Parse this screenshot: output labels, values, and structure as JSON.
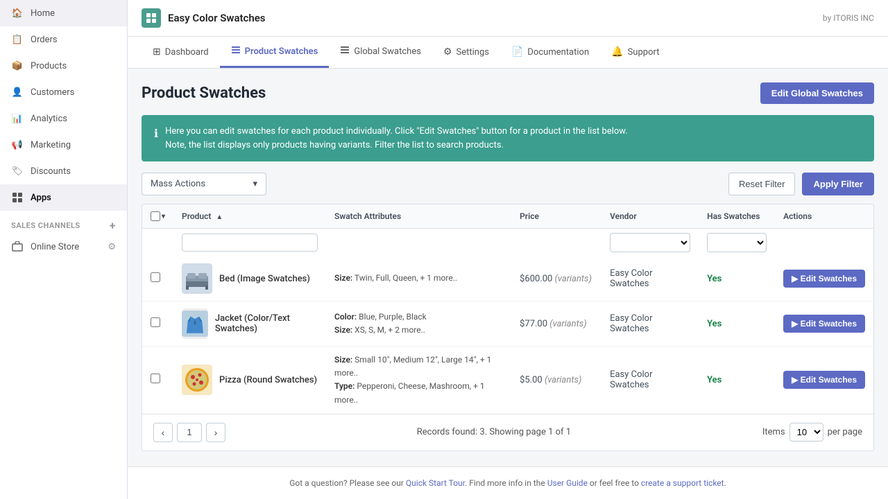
{
  "sidebar": {
    "items": [
      {
        "label": "Home",
        "icon": "🏠",
        "active": false
      },
      {
        "label": "Orders",
        "icon": "📋",
        "active": false
      },
      {
        "label": "Products",
        "icon": "📦",
        "active": false
      },
      {
        "label": "Customers",
        "icon": "👤",
        "active": false
      },
      {
        "label": "Analytics",
        "icon": "📊",
        "active": false
      },
      {
        "label": "Marketing",
        "icon": "📢",
        "active": false
      },
      {
        "label": "Discounts",
        "icon": "🏷",
        "active": false
      },
      {
        "label": "Apps",
        "icon": "⚙",
        "active": true
      }
    ],
    "sales_channels_label": "SALES CHANNELS",
    "online_store_label": "Online Store"
  },
  "app_header": {
    "title": "Easy Color Swatches",
    "by_label": "by ITORIS INC"
  },
  "tabs": [
    {
      "label": "Dashboard",
      "icon": "⊞",
      "active": false
    },
    {
      "label": "Product Swatches",
      "icon": "≡",
      "active": true
    },
    {
      "label": "Global Swatches",
      "icon": "≡",
      "active": false
    },
    {
      "label": "Settings",
      "icon": "⚙",
      "active": false
    },
    {
      "label": "Documentation",
      "icon": "📄",
      "active": false
    },
    {
      "label": "Support",
      "icon": "🔔",
      "active": false
    }
  ],
  "page": {
    "title": "Product Swatches",
    "edit_global_btn": "Edit Global Swatches",
    "info_text_line1": "Here you can edit swatches for each product individually. Click \"Edit Swatches\" button for a product in the list below.",
    "info_text_line2": "Note, the list displays only products having variants. Filter the list to search products."
  },
  "filter": {
    "mass_actions_label": "Mass Actions",
    "reset_filter_btn": "Reset Filter",
    "apply_filter_btn": "Apply Filter"
  },
  "table": {
    "columns": [
      "Product",
      "Swatch Attributes",
      "Price",
      "Vendor",
      "Has Swatches",
      "Actions"
    ],
    "rows": [
      {
        "id": 1,
        "name": "Bed (Image Swatches)",
        "img_label": "bed",
        "swatch_attrs": [
          {
            "label": "Size",
            "value": "Twin, Full, Queen, + 1 more.."
          }
        ],
        "price": "$600.00",
        "price_note": "(variants)",
        "vendor": "Easy Color Swatches",
        "has_swatches": "Yes",
        "action_btn": "▶ Edit Swatches"
      },
      {
        "id": 2,
        "name": "Jacket (Color/Text Swatches)",
        "img_label": "jacket",
        "swatch_attrs": [
          {
            "label": "Color",
            "value": "Blue, Purple, Black"
          },
          {
            "label": "Size",
            "value": "XS, S, M, + 2 more.."
          }
        ],
        "price": "$77.00",
        "price_note": "(variants)",
        "vendor": "Easy Color Swatches",
        "has_swatches": "Yes",
        "action_btn": "▶ Edit Swatches"
      },
      {
        "id": 3,
        "name": "Pizza (Round Swatches)",
        "img_label": "pizza",
        "swatch_attrs": [
          {
            "label": "Size",
            "value": "Small 10\", Medium 12\", Large 14\", + 1 more.."
          },
          {
            "label": "Type",
            "value": "Pepperoni, Cheese, Mashroom, + 1 more.."
          }
        ],
        "price": "$5.00",
        "price_note": "(variants)",
        "vendor": "Easy Color Swatches",
        "has_swatches": "Yes",
        "action_btn": "▶ Edit Swatches"
      }
    ]
  },
  "pagination": {
    "current_page": "1",
    "records_info": "Records found: 3. Showing page 1 of 1",
    "items_label": "Items",
    "per_page_value": "10",
    "per_page_label": "per page"
  },
  "footer": {
    "text_prefix": "Got a question? Please see our ",
    "quick_start_label": "Quick Start Tour",
    "text_mid": ". Find more info in the ",
    "user_guide_label": "User Guide",
    "text_mid2": " or feel free to ",
    "support_ticket_label": "create a support ticket",
    "text_suffix": "."
  }
}
